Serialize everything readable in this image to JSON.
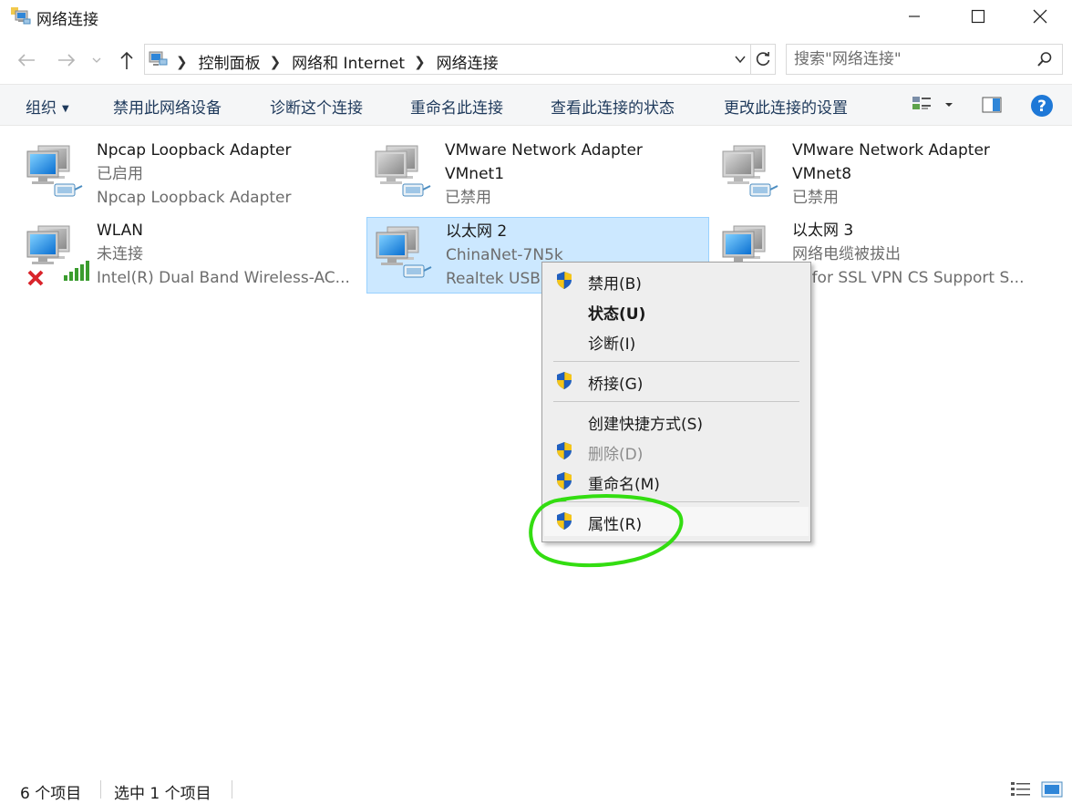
{
  "window": {
    "title": "网络连接",
    "controls": [
      "minimize-icon",
      "maximize-icon",
      "close-icon"
    ]
  },
  "address": {
    "breadcrumbs": [
      "控制面板",
      "网络和 Internet",
      "网络连接"
    ],
    "search_placeholder": "搜索\"网络连接\""
  },
  "toolbar": {
    "organize": "组织",
    "disable": "禁用此网络设备",
    "diagnose": "诊断这个连接",
    "rename": "重命名此连接",
    "view_status": "查看此连接的状态",
    "change_settings": "更改此连接的设置"
  },
  "connections": [
    {
      "name": "Npcap Loopback Adapter",
      "status": "已启用",
      "device": "Npcap Loopback Adapter",
      "icon": "network-adapter-icon"
    },
    {
      "name": "VMware Network Adapter",
      "name2": "VMnet1",
      "status": "已禁用",
      "icon": "network-adapter-disabled-icon"
    },
    {
      "name": "VMware Network Adapter",
      "name2": "VMnet8",
      "status": "已禁用",
      "icon": "network-adapter-disabled-icon"
    },
    {
      "name": "WLAN",
      "status": "未连接",
      "device": "Intel(R) Dual Band Wireless-AC...",
      "icon": "wireless-adapter-icon"
    },
    {
      "name": "以太网 2",
      "status": "ChinaNet-7N5k",
      "device": "Realtek USB",
      "icon": "network-adapter-icon",
      "selected": true
    },
    {
      "name": "以太网 3",
      "status": "网络电缆被拔出",
      "device": "ngfor SSL VPN CS Support S...",
      "icon": "network-adapter-icon"
    }
  ],
  "context_menu": {
    "items": [
      {
        "label": "禁用(B)",
        "shield": true
      },
      {
        "label": "状态(U)",
        "bold": true
      },
      {
        "label": "诊断(I)"
      },
      {
        "label": "桥接(G)",
        "shield": true
      },
      {
        "label": "创建快捷方式(S)"
      },
      {
        "label": "删除(D)",
        "shield": true,
        "disabled": true
      },
      {
        "label": "重命名(M)",
        "shield": true
      },
      {
        "label": "属性(R)",
        "shield": true,
        "highlighted": true
      }
    ]
  },
  "status_bar": {
    "item_count": "6 个项目",
    "selected_count": "选中 1 个项目"
  },
  "colors": {
    "accent_text": "#1e395b",
    "selection_bg": "#cce8ff",
    "annotation_green": "#33dd11",
    "help_blue": "#1e78d7"
  }
}
